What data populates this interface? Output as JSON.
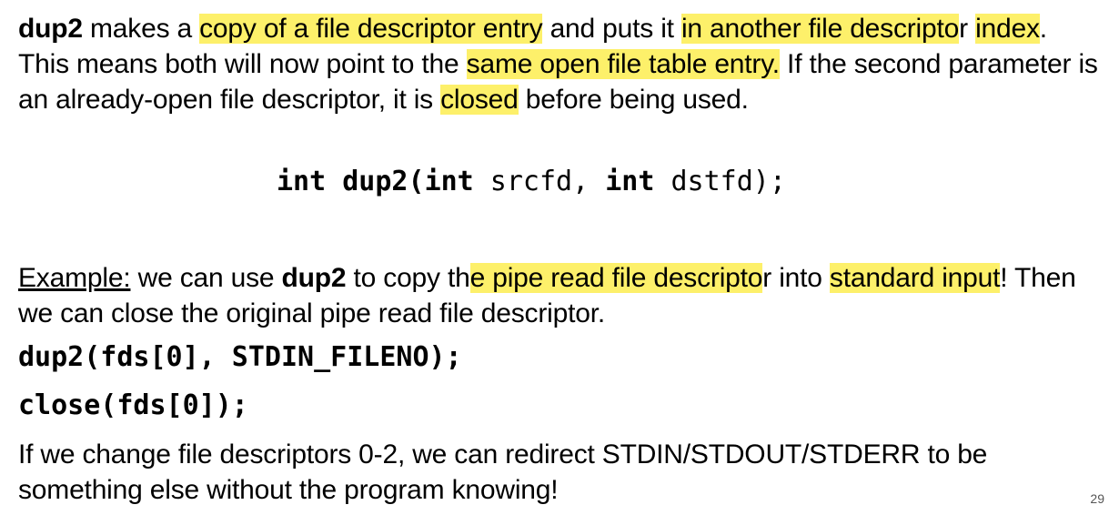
{
  "paragraph1": {
    "t1": "dup2",
    "t2": " makes a ",
    "t3": "copy of a file descriptor entry",
    "t4": " and puts it ",
    "t5": "in another file descripto",
    "t6": "r ",
    "t7": "index",
    "t8": ".  This means both will now point to the ",
    "t9": "same open file table entry.",
    "t10": "  If the second parameter is an already-open file descriptor, it is ",
    "t11": "closed",
    "t12": " before being used."
  },
  "signature": {
    "kw1": "int",
    "fn": " dup2(",
    "kw2": "int",
    "arg1": " srcfd, ",
    "kw3": "int",
    "arg2": " dstfd);"
  },
  "paragraph2": {
    "t1": "Example:",
    "t2": " we can use ",
    "t3": "dup2",
    "t4": " to copy th",
    "t5": "e pipe read file descripto",
    "t6": "r into ",
    "t7": "standard input",
    "t8": "!  Then we can close the original pipe read file descriptor."
  },
  "code": {
    "line1": "dup2(fds[0], STDIN_FILENO);",
    "line2": "close(fds[0]);"
  },
  "paragraph3": {
    "text": "If we change file descriptors 0-2, we can redirect STDIN/STDOUT/STDERR to be something else without the program knowing!"
  },
  "slide_number": "29",
  "colors": {
    "highlight": "#fdf06a"
  }
}
